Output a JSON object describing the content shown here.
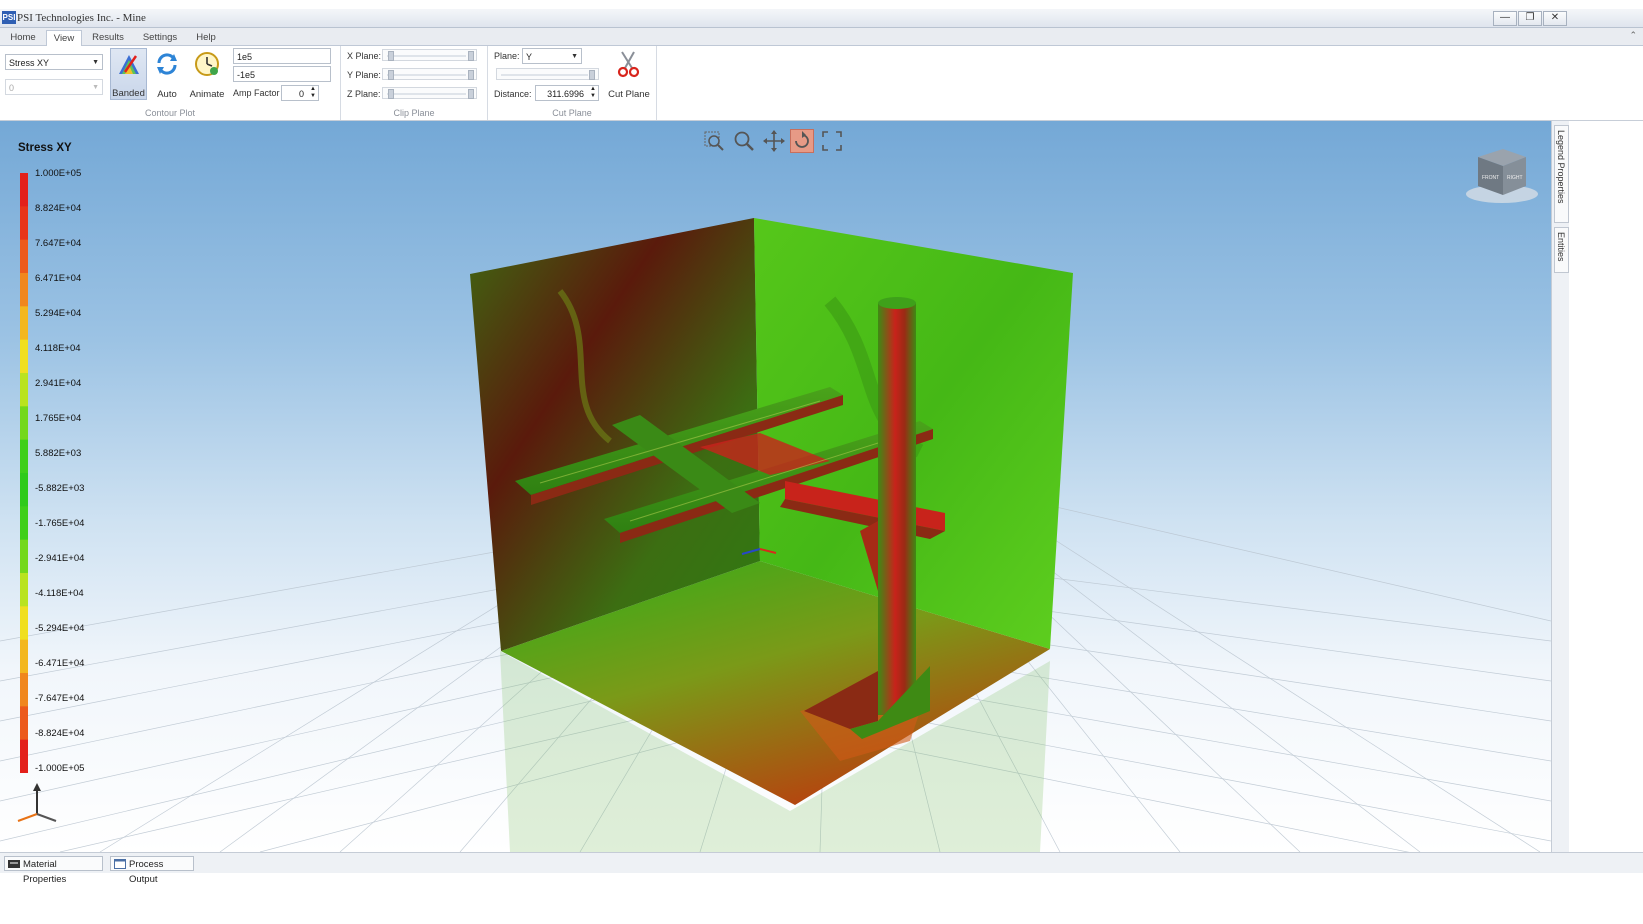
{
  "window": {
    "app_icon": "PSI",
    "title": "PSI Technologies Inc. - Mine",
    "buttons": {
      "minimize": "—",
      "restore": "❐",
      "close": "✕"
    }
  },
  "ribbon_tabs": [
    {
      "label": "Home",
      "active": false
    },
    {
      "label": "View",
      "active": true
    },
    {
      "label": "Results",
      "active": false
    },
    {
      "label": "Settings",
      "active": false
    },
    {
      "label": "Help",
      "active": false
    }
  ],
  "contour_plot": {
    "result_select": "Stress XY",
    "step_select": "0",
    "max_value": "1e5",
    "min_value": "-1e5",
    "amp_factor_label": "Amp Factor",
    "amp_factor_value": "0",
    "banded_label": "Banded",
    "auto_label": "Auto",
    "animate_label": "Animate",
    "group_label": "Contour Plot"
  },
  "clip_plane": {
    "x_label": "X Plane:",
    "y_label": "Y Plane:",
    "z_label": "Z Plane:",
    "group_label": "Clip Plane"
  },
  "cut_plane": {
    "plane_label": "Plane:",
    "plane_value": "Y",
    "distance_label": "Distance:",
    "distance_value": "311.6996",
    "cut_plane_button": "Cut Plane",
    "group_label": "Cut Plane"
  },
  "legend": {
    "title": "Stress XY",
    "labels": [
      "1.000E+05",
      "8.824E+04",
      "7.647E+04",
      "6.471E+04",
      "5.294E+04",
      "4.118E+04",
      "2.941E+04",
      "1.765E+04",
      "5.882E+03",
      "-5.882E+03",
      "-1.765E+04",
      "-2.941E+04",
      "-4.118E+04",
      "-5.294E+04",
      "-6.471E+04",
      "-7.647E+04",
      "-8.824E+04",
      "-1.000E+05"
    ],
    "colors": [
      "#e3201b",
      "#e8341a",
      "#ec5a1c",
      "#f0871e",
      "#f3b71f",
      "#f0df1f",
      "#b9e31f",
      "#74d81c",
      "#3fcf1a",
      "#2fca1a",
      "#3fcf1a",
      "#74d81c",
      "#b9e31f",
      "#f0df1f",
      "#f3b71f",
      "#f0871e",
      "#ec5a1c",
      "#e3201b"
    ]
  },
  "view_cube": {
    "front": "FRONT",
    "right": "RIGHT"
  },
  "side_tabs": [
    "Legend Properties",
    "Entities"
  ],
  "status_buttons": [
    "Material Properties",
    "Process Output"
  ],
  "colors": {
    "accent": "#2f5fb3",
    "sky_top": "#74a8d6",
    "stress_high": "#c8231b",
    "stress_low": "#2fca1a",
    "dark_red": "#5a1a0c"
  }
}
